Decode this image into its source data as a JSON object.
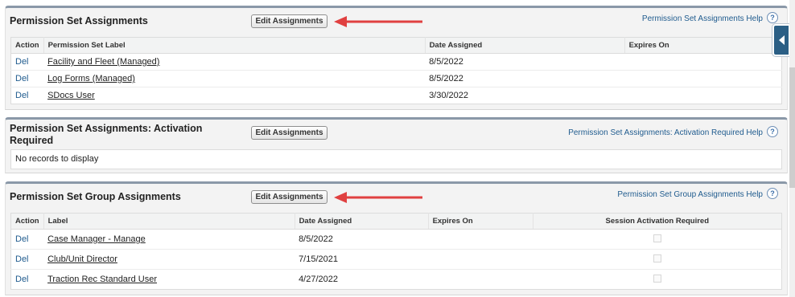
{
  "colors": {
    "panel_border": "#8a98a8",
    "link": "#1f5b8e",
    "arrow": "#e04040",
    "side_tab": "#2b5f85"
  },
  "section1": {
    "title": "Permission Set Assignments",
    "button": "Edit Assignments",
    "help": "Permission Set Assignments Help",
    "help_icon": "?",
    "columns": [
      "Action",
      "Permission Set Label",
      "Date Assigned",
      "Expires On"
    ],
    "rows": [
      {
        "action": "Del",
        "label": "Facility and Fleet (Managed)",
        "date": "8/5/2022",
        "expires": ""
      },
      {
        "action": "Del",
        "label": "Log Forms (Managed)",
        "date": "8/5/2022",
        "expires": ""
      },
      {
        "action": "Del",
        "label": "SDocs User",
        "date": "3/30/2022",
        "expires": ""
      }
    ]
  },
  "section2": {
    "title": "Permission Set Assignments: Activation Required",
    "button": "Edit Assignments",
    "help": "Permission Set Assignments: Activation Required Help",
    "help_icon": "?",
    "empty": "No records to display"
  },
  "section3": {
    "title": "Permission Set Group Assignments",
    "button": "Edit Assignments",
    "help": "Permission Set Group Assignments Help",
    "help_icon": "?",
    "columns": [
      "Action",
      "Label",
      "Date Assigned",
      "Expires On",
      "Session Activation Required"
    ],
    "rows": [
      {
        "action": "Del",
        "label": "Case Manager - Manage",
        "date": "8/5/2022",
        "expires": ""
      },
      {
        "action": "Del",
        "label": "Club/Unit Director",
        "date": "7/15/2021",
        "expires": ""
      },
      {
        "action": "Del",
        "label": "Traction Rec Standard User",
        "date": "4/27/2022",
        "expires": ""
      }
    ]
  },
  "icons": {
    "side_tab": "chevron-left-icon",
    "arrow": "red-arrow-pointing-left",
    "help": "question-circle-icon"
  }
}
